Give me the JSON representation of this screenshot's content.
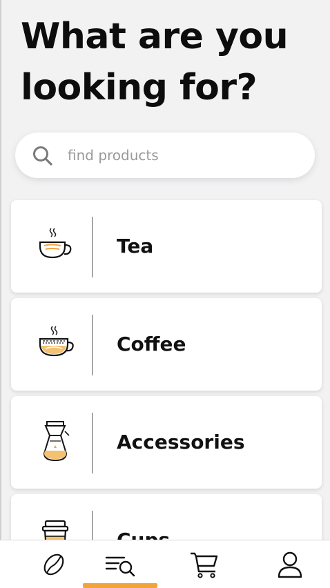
{
  "header": {
    "title": "What are you looking for?"
  },
  "search": {
    "placeholder": "find products",
    "value": "",
    "icon": "search-icon"
  },
  "categories": [
    {
      "label": "Tea",
      "icon": "tea-cup-icon"
    },
    {
      "label": "Coffee",
      "icon": "coffee-cup-icon"
    },
    {
      "label": "Accessories",
      "icon": "coffee-maker-icon"
    },
    {
      "label": "Cups",
      "icon": "takeaway-cup-icon"
    }
  ],
  "tabbar": {
    "tabs": [
      {
        "name": "home",
        "icon": "coffee-bean-icon"
      },
      {
        "name": "search",
        "icon": "search-list-icon",
        "active": true
      },
      {
        "name": "cart",
        "icon": "cart-icon"
      },
      {
        "name": "profile",
        "icon": "user-icon"
      }
    ],
    "active_color": "#f2a43b"
  },
  "colors": {
    "background": "#f2f2f3",
    "accent": "#f2a43b",
    "text": "#0d0d0d"
  }
}
